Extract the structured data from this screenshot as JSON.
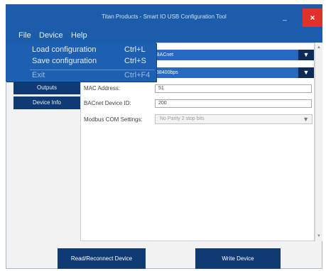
{
  "window": {
    "title": "Titan Products - Smart IO USB Configuration Tool",
    "minimize": "_",
    "maximize": "□",
    "close": "×"
  },
  "menubar": {
    "file": "File",
    "device": "Device",
    "help": "Help"
  },
  "file_menu": {
    "items": [
      {
        "label": "Load configuration",
        "shortcut": "Ctrl+L"
      },
      {
        "label": "Save configuration",
        "shortcut": "Ctrl+S"
      },
      {
        "label": "Exit",
        "shortcut": "Ctrl+F4"
      }
    ]
  },
  "sidebar": {
    "items": [
      {
        "label": "Outputs"
      },
      {
        "label": "Device Info"
      }
    ]
  },
  "form": {
    "protocol": {
      "value": "BACnet"
    },
    "baud_rate": {
      "value": "38400bps"
    },
    "mac_address": {
      "label": "MAC Address:",
      "value": "51"
    },
    "bacnet_device_id": {
      "label": "BACnet Device ID:",
      "value": "200"
    },
    "modbus_com_settings": {
      "label": "Modbus COM Settings:",
      "value": "No Parity 2 stop bits"
    }
  },
  "actions": {
    "read_label": "Read/Reconnect Device",
    "write_label": "Write Device"
  },
  "colors": {
    "title_bar": "#1c5dab",
    "accent_dark": "#0f3a73",
    "close": "#e0312a"
  }
}
